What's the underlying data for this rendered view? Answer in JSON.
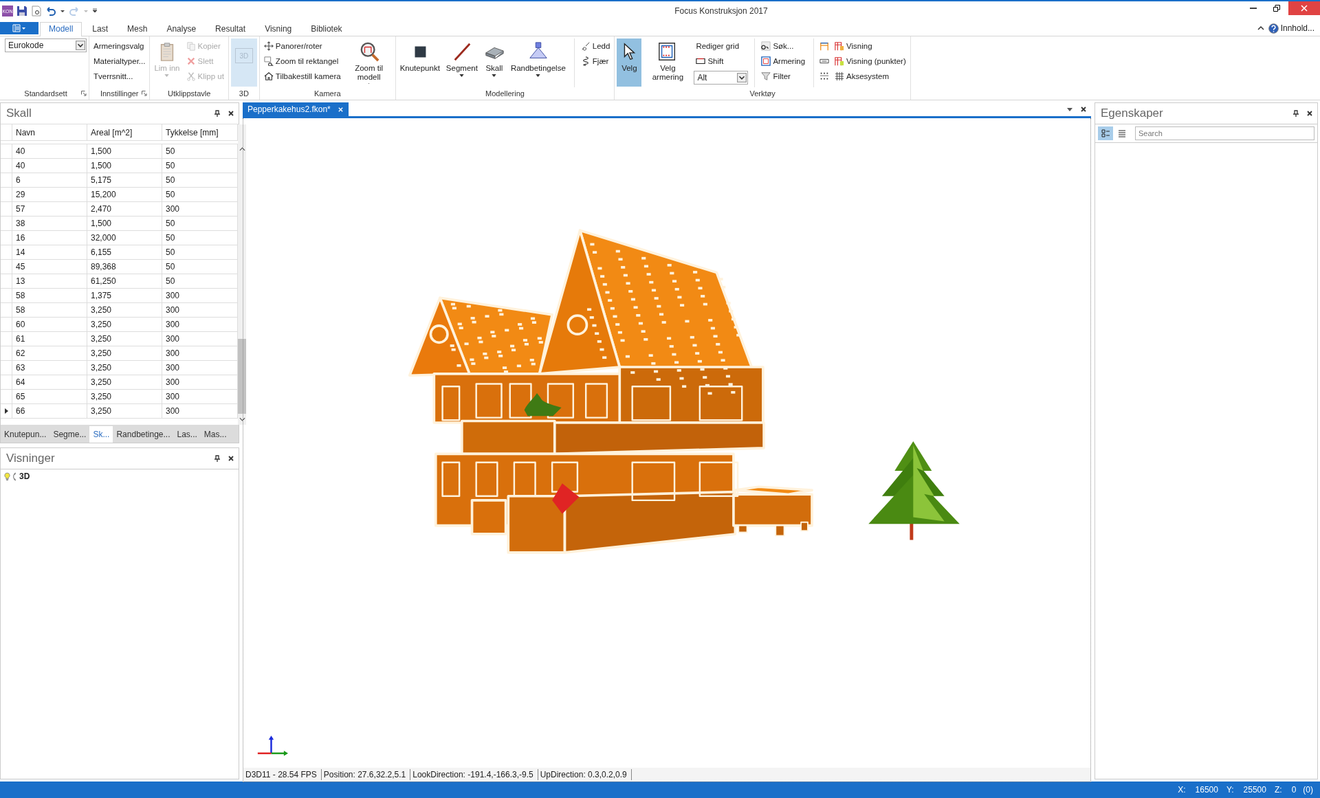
{
  "window": {
    "title": "Focus Konstruksjon 2017"
  },
  "quick_access": {
    "logo": "KON"
  },
  "ribbon": {
    "tabs": [
      {
        "label": "Modell",
        "selected": true
      },
      {
        "label": "Last",
        "selected": false
      },
      {
        "label": "Mesh",
        "selected": false
      },
      {
        "label": "Analyse",
        "selected": false
      },
      {
        "label": "Resultat",
        "selected": false
      },
      {
        "label": "Visning",
        "selected": false
      },
      {
        "label": "Bibliotek",
        "selected": false
      }
    ],
    "help": "Innhold...",
    "groups": [
      {
        "label": "Standardsett",
        "launcher": true,
        "columns": [
          {
            "divided": false,
            "items": [
              {
                "kind": "select",
                "label": "Eurokode",
                "disabled": false,
                "selected": false,
                "menu": true
              }
            ]
          }
        ]
      },
      {
        "label": "Innstillinger",
        "launcher": true,
        "columns": [
          {
            "divided": false,
            "items": [
              {
                "kind": "small",
                "label": "Armeringsvalg",
                "disabled": false,
                "selected": false,
                "menu": false
              },
              {
                "kind": "small",
                "label": "Materialtyper...",
                "disabled": false,
                "selected": false,
                "menu": false
              },
              {
                "kind": "small",
                "label": "Tverrsnitt...",
                "disabled": false,
                "selected": false,
                "menu": false
              }
            ]
          }
        ]
      },
      {
        "label": "Utklippstavle",
        "launcher": false,
        "columns": [
          {
            "divided": false,
            "items": [
              {
                "kind": "large",
                "label": "Lim inn",
                "disabled": true,
                "selected": false,
                "menu": true
              }
            ]
          },
          {
            "divided": false,
            "items": [
              {
                "kind": "small",
                "label": "Kopier",
                "disabled": true,
                "selected": false,
                "menu": false
              },
              {
                "kind": "small",
                "label": "Slett",
                "disabled": true,
                "selected": false,
                "menu": false
              },
              {
                "kind": "small",
                "label": "Klipp ut",
                "disabled": true,
                "selected": false,
                "menu": false
              }
            ]
          }
        ]
      },
      {
        "label": "3D",
        "launcher": false,
        "columns": [
          {
            "divided": false,
            "items": [
              {
                "kind": "tile",
                "label": "3D",
                "disabled": true,
                "selected": true,
                "menu": false
              }
            ]
          }
        ]
      },
      {
        "label": "Kamera",
        "launcher": false,
        "columns": [
          {
            "divided": false,
            "items": [
              {
                "kind": "small",
                "label": "Panorer/roter",
                "disabled": false,
                "selected": false,
                "menu": false
              },
              {
                "kind": "small",
                "label": "Zoom til rektangel",
                "disabled": false,
                "selected": false,
                "menu": false
              },
              {
                "kind": "small",
                "label": "Tilbakestill kamera",
                "disabled": false,
                "selected": false,
                "menu": false
              }
            ]
          },
          {
            "divided": false,
            "items": [
              {
                "kind": "large",
                "label": "Zoom til modell",
                "disabled": false,
                "selected": false,
                "menu": true
              }
            ]
          }
        ]
      },
      {
        "label": "Modellering",
        "launcher": false,
        "columns": [
          {
            "divided": false,
            "items": [
              {
                "kind": "large",
                "label": "Knutepunkt",
                "disabled": false,
                "selected": false,
                "menu": false
              }
            ]
          },
          {
            "divided": false,
            "items": [
              {
                "kind": "large",
                "label": "Segment",
                "disabled": false,
                "selected": false,
                "menu": true
              }
            ]
          },
          {
            "divided": false,
            "items": [
              {
                "kind": "large",
                "label": "Skall",
                "disabled": false,
                "selected": false,
                "menu": true
              }
            ]
          },
          {
            "divided": false,
            "items": [
              {
                "kind": "large",
                "label": "Randbetingelse",
                "disabled": false,
                "selected": false,
                "menu": true
              }
            ]
          },
          {
            "divided": true,
            "items": [
              {
                "kind": "small",
                "label": "Ledd",
                "disabled": false,
                "selected": false,
                "menu": false
              },
              {
                "kind": "small",
                "label": "Fjær",
                "disabled": false,
                "selected": false,
                "menu": false
              }
            ]
          }
        ]
      },
      {
        "label": "Verktøy",
        "launcher": false,
        "columns": [
          {
            "divided": false,
            "items": [
              {
                "kind": "large",
                "label": "Velg",
                "disabled": false,
                "selected": true,
                "menu": false
              }
            ]
          },
          {
            "divided": false,
            "items": [
              {
                "kind": "large",
                "label": "Velg armering",
                "disabled": false,
                "selected": false,
                "menu": false
              }
            ]
          },
          {
            "divided": false,
            "items": [
              {
                "kind": "small",
                "label": "Rediger grid",
                "disabled": false,
                "selected": false,
                "menu": false
              },
              {
                "kind": "small",
                "label": "Shift",
                "disabled": false,
                "selected": false,
                "menu": false
              },
              {
                "kind": "select",
                "label": "Alt",
                "disabled": false,
                "selected": false,
                "menu": true
              }
            ]
          },
          {
            "divided": true,
            "items": [
              {
                "kind": "small",
                "label": "Søk...",
                "disabled": false,
                "selected": false,
                "menu": false
              },
              {
                "kind": "small",
                "label": "Armering",
                "disabled": false,
                "selected": false,
                "menu": false
              },
              {
                "kind": "small",
                "label": "Filter",
                "disabled": false,
                "selected": false,
                "menu": false
              }
            ]
          },
          {
            "divided": true,
            "items": [
              {
                "kind": "icon",
                "disabled": false,
                "selected": false,
                "menu": false
              },
              {
                "kind": "icon",
                "disabled": false,
                "selected": false,
                "menu": false
              },
              {
                "kind": "icon",
                "disabled": false,
                "selected": false,
                "menu": false
              }
            ]
          },
          {
            "divided": false,
            "items": [
              {
                "kind": "small",
                "label": "Visning",
                "disabled": false,
                "selected": false,
                "menu": false
              },
              {
                "kind": "small",
                "label": "Visning (punkter)",
                "disabled": false,
                "selected": false,
                "menu": false
              },
              {
                "kind": "small",
                "label": "Aksesystem",
                "disabled": false,
                "selected": false,
                "menu": false
              }
            ]
          }
        ]
      }
    ]
  },
  "shell_panel": {
    "title": "Skall",
    "table": {
      "columns": [
        "Navn",
        "Areal [m^2]",
        "Tykkelse [mm]"
      ],
      "rows": [
        {
          "cells": [
            "40",
            "1,500",
            "50"
          ],
          "current": false
        },
        {
          "cells": [
            "40",
            "1,500",
            "50"
          ],
          "current": false
        },
        {
          "cells": [
            "6",
            "5,175",
            "50"
          ],
          "current": false
        },
        {
          "cells": [
            "29",
            "15,200",
            "50"
          ],
          "current": false
        },
        {
          "cells": [
            "57",
            "2,470",
            "300"
          ],
          "current": false
        },
        {
          "cells": [
            "38",
            "1,500",
            "50"
          ],
          "current": false
        },
        {
          "cells": [
            "16",
            "32,000",
            "50"
          ],
          "current": false
        },
        {
          "cells": [
            "14",
            "6,155",
            "50"
          ],
          "current": false
        },
        {
          "cells": [
            "45",
            "89,368",
            "50"
          ],
          "current": false
        },
        {
          "cells": [
            "13",
            "61,250",
            "50"
          ],
          "current": false
        },
        {
          "cells": [
            "58",
            "1,375",
            "300"
          ],
          "current": false
        },
        {
          "cells": [
            "58",
            "3,250",
            "300"
          ],
          "current": false
        },
        {
          "cells": [
            "60",
            "3,250",
            "300"
          ],
          "current": false
        },
        {
          "cells": [
            "61",
            "3,250",
            "300"
          ],
          "current": false
        },
        {
          "cells": [
            "62",
            "3,250",
            "300"
          ],
          "current": false
        },
        {
          "cells": [
            "63",
            "3,250",
            "300"
          ],
          "current": false
        },
        {
          "cells": [
            "64",
            "3,250",
            "300"
          ],
          "current": false
        },
        {
          "cells": [
            "65",
            "3,250",
            "300"
          ],
          "current": false
        },
        {
          "cells": [
            "66",
            "3,250",
            "300"
          ],
          "current": true
        }
      ]
    },
    "tabs": [
      {
        "label": "Knutepun...",
        "selected": false
      },
      {
        "label": "Segme...",
        "selected": false
      },
      {
        "label": "Sk...",
        "selected": true
      },
      {
        "label": "Randbetinge...",
        "selected": false
      },
      {
        "label": "Las...",
        "selected": false
      },
      {
        "label": "Mas...",
        "selected": false
      }
    ]
  },
  "views_panel": {
    "title": "Visninger",
    "items": [
      {
        "label": "3D"
      }
    ]
  },
  "document": {
    "tabs": [
      {
        "label": "Pepperkakehus2.fkon*",
        "selected": true
      }
    ],
    "status": [
      "D3D11 - 28.54 FPS",
      "Position: 27.6,32.2,5.1",
      "LookDirection: -191.4,-166.3,-9.5",
      "UpDirection: 0.3,0.2,0.9"
    ]
  },
  "properties_panel": {
    "title": "Egenskaper",
    "view_modes": [
      {
        "selected": true
      },
      {
        "selected": false
      }
    ],
    "search": {
      "placeholder": "Search"
    }
  },
  "status_bar": {
    "coords": [
      {
        "label": "X:",
        "value": "16500"
      },
      {
        "label": "Y:",
        "value": "25500"
      },
      {
        "label": "Z:",
        "value": "0"
      }
    ],
    "extra": "(0)"
  }
}
